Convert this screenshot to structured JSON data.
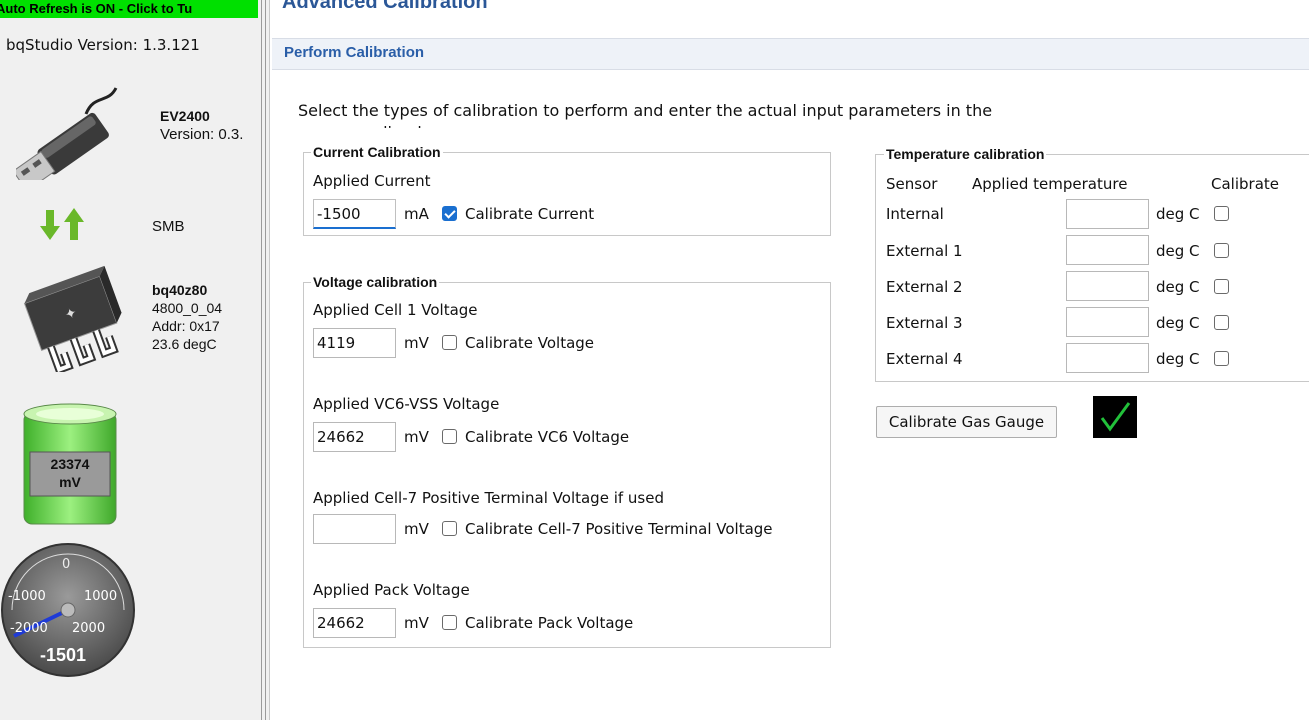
{
  "sidebar": {
    "refresh_text": "Auto Refresh is ON - Click to Tu",
    "version_text": "bqStudio Version:  1.3.121",
    "device": {
      "name": "EV2400",
      "version": "Version: 0.3."
    },
    "bus": "SMB",
    "chip": {
      "name": "bq40z80",
      "fw": "4800_0_04",
      "addr": "Addr: 0x17",
      "temp": "23.6 degC"
    },
    "battery": {
      "value": "23374",
      "unit": "mV"
    },
    "gauge": {
      "zero": "0",
      "neg1000": "-1000",
      "pos1000": "1000",
      "neg2000": "-2000",
      "pos2000": "2000",
      "reading": "-1501",
      "reading_value": -1501,
      "range": [
        -2000,
        2000
      ]
    }
  },
  "main": {
    "title": "Advanced Calibration",
    "subtitle": "Perform Calibration",
    "intro": "Select the types of calibration to perform and enter the actual input parameters in the corresponding boxes.",
    "current": {
      "group_title": "Current Calibration",
      "label": "Applied Current",
      "value": "-1500",
      "unit": "mA",
      "checkbox_label": "Calibrate Current",
      "checked": true
    },
    "voltage": {
      "group_title": "Voltage calibration",
      "rows": [
        {
          "label": "Applied Cell 1 Voltage",
          "value": "4119",
          "unit": "mV",
          "checkbox_label": "Calibrate Voltage",
          "checked": false
        },
        {
          "label": "Applied VC6-VSS Voltage",
          "value": "24662",
          "unit": "mV",
          "checkbox_label": "Calibrate VC6 Voltage",
          "checked": false
        },
        {
          "label": "Applied Cell-7 Positive Terminal Voltage if used",
          "value": "",
          "unit": "mV",
          "checkbox_label": "Calibrate Cell-7 Positive Terminal Voltage",
          "checked": false
        },
        {
          "label": "Applied Pack Voltage",
          "value": "24662",
          "unit": "mV",
          "checkbox_label": "Calibrate Pack Voltage",
          "checked": false
        }
      ]
    },
    "temperature": {
      "group_title": "Temperature calibration",
      "headers": {
        "sensor": "Sensor",
        "applied": "Applied temperature",
        "calibrate": "Calibrate"
      },
      "rows": [
        {
          "sensor": "Internal",
          "value": "",
          "unit": "deg C",
          "checked": false
        },
        {
          "sensor": "External 1",
          "value": "",
          "unit": "deg C",
          "checked": false
        },
        {
          "sensor": "External 2",
          "value": "",
          "unit": "deg C",
          "checked": false
        },
        {
          "sensor": "External 3",
          "value": "",
          "unit": "deg C",
          "checked": false
        },
        {
          "sensor": "External 4",
          "value": "",
          "unit": "deg C",
          "checked": false
        }
      ]
    },
    "calibrate_button": "Calibrate Gas Gauge",
    "status_icon": "checkmark-icon",
    "colors": {
      "accent": "#1a6fd0",
      "title": "#2b5797",
      "refresh_bar": "#00e000",
      "battery": "#6fdc5a",
      "check": "#22c03a"
    }
  }
}
